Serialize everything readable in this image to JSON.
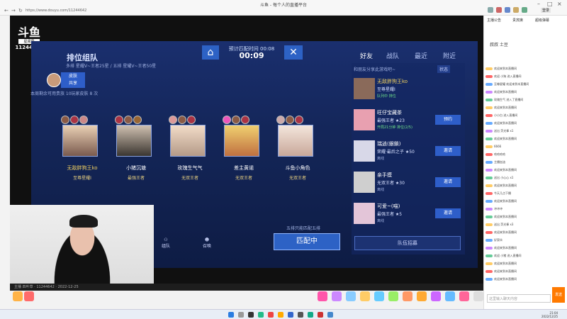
{
  "window": {
    "title": "斗鱼 - 每个人的直播平台",
    "url": "https://www.douyu.com/11244642",
    "login": "登录"
  },
  "logo": {
    "brand": "斗鱼",
    "tag": "星阅号",
    "room_id": "11244642"
  },
  "game": {
    "mode_title": "排位组队",
    "mode_sub": "多排 星耀V~王者25星 / 五排 星耀V~王者50星",
    "timer_label": "预计匹配时间 00:08",
    "timer_value": "00:09",
    "tabs": [
      "好友",
      "战队",
      "最近",
      "附近"
    ],
    "skin_share": "皮肤\n共享",
    "skin_tip": "本周剩余可用贵族 10玩家皮肤 8 次",
    "players": [
      {
        "name": "无敌胖狗王ko",
        "rank": "至尊星耀I"
      },
      {
        "name": "小猪沉塘",
        "rank": "最强王者"
      },
      {
        "name": "玫瑰生气气",
        "rank": "无双王者"
      },
      {
        "name": "差主黄诺",
        "rank": "无双王者"
      },
      {
        "name": "斗鱼小角色",
        "rank": "无双王者"
      }
    ],
    "room_hint": "五排只能匹配五排",
    "match_button": "匹配中",
    "bottom_icons": [
      "组队",
      "召唤"
    ],
    "friends_hint": "和朋友分享此游戏吧~",
    "status_button": "状态",
    "friends": [
      {
        "name": "无敌胖狗王ko",
        "rank": "至尊星耀I",
        "status": "队列中 排位",
        "button": ""
      },
      {
        "name": "旺仔宝藏茶",
        "rank": "最强王者 ★23",
        "status": "开局21分钟 排位(2/5)",
        "button": "预约"
      },
      {
        "name": "瑞逍(銀鎖)",
        "rank": "荣耀·最后之子 ★50",
        "status": "离线",
        "button": "邀请"
      },
      {
        "name": "亲手摸",
        "rank": "无双王者 ★30",
        "status": "离线",
        "button": "邀请"
      },
      {
        "name": "可爱~(喵)",
        "rank": "最强王者 ★5",
        "status": "离线",
        "button": "邀请"
      }
    ],
    "recruit_button": "队伍招募"
  },
  "player_bar": "主播 四叶草 · 11244642 · 2022-12-25",
  "sidebar": {
    "tabs": [
      "主播公告",
      "贵宾席",
      "超级弹幕"
    ],
    "host": "叔叔 土豆",
    "chat": [
      "欢迎来到本直播间",
      "欢迎 小狗 进入直播间",
      "至尊星耀 欢迎来到本直播间",
      "欢迎来到本直播间",
      "玫瑰生气 进入了直播间",
      "欢迎来到本直播间",
      "小小白 进入直播间",
      "欢迎来到本直播间",
      "送出 荧光棒 x1",
      "欢迎来到本直播间",
      "6666",
      "哈哈哈哈",
      "主播加油",
      "欢迎来到本直播间",
      "送出 小心心 x1",
      "欢迎来到本直播间",
      "今天几点下播",
      "欢迎来到本直播间",
      "冲冲冲",
      "欢迎来到本直播间",
      "送出 荧光棒 x3",
      "欢迎来到本直播间",
      "好家伙",
      "欢迎来到本直播间",
      "欢迎 小猪 进入直播间",
      "欢迎来到本直播间",
      "欢迎来到本直播间",
      "欢迎来到本直播间"
    ],
    "input_placeholder": "这里输入聊天内容",
    "send": "发送"
  },
  "clock": {
    "time": "21:04",
    "date": "2022/12/25"
  },
  "colors": {
    "accent": "#2d62c5",
    "brand": "#ff7a00",
    "game_bg": "#142659"
  }
}
